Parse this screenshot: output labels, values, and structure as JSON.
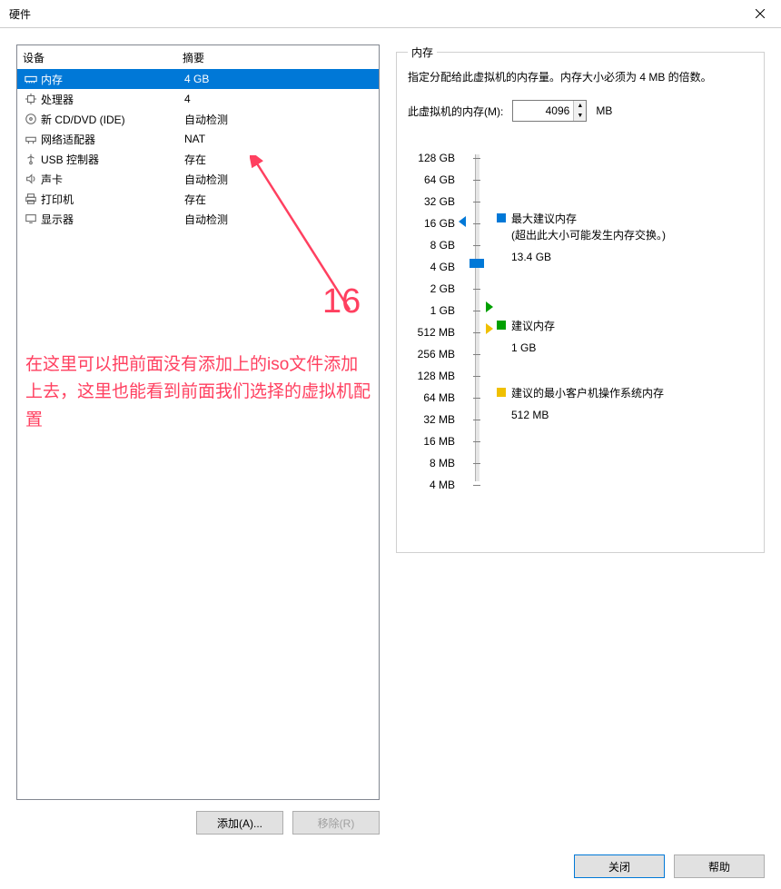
{
  "window": {
    "title": "硬件"
  },
  "device_list": {
    "header_device": "设备",
    "header_summary": "摘要",
    "items": [
      {
        "name": "内存",
        "summary": "4 GB",
        "icon": "memory-icon",
        "selected": true
      },
      {
        "name": "处理器",
        "summary": "4",
        "icon": "cpu-icon",
        "selected": false
      },
      {
        "name": "新 CD/DVD (IDE)",
        "summary": "自动检测",
        "icon": "disc-icon",
        "selected": false
      },
      {
        "name": "网络适配器",
        "summary": "NAT",
        "icon": "network-icon",
        "selected": false
      },
      {
        "name": "USB 控制器",
        "summary": "存在",
        "icon": "usb-icon",
        "selected": false
      },
      {
        "name": "声卡",
        "summary": "自动检测",
        "icon": "sound-icon",
        "selected": false
      },
      {
        "name": "打印机",
        "summary": "存在",
        "icon": "printer-icon",
        "selected": false
      },
      {
        "name": "显示器",
        "summary": "自动检测",
        "icon": "display-icon",
        "selected": false
      }
    ]
  },
  "buttons": {
    "add": "添加(A)...",
    "remove": "移除(R)",
    "close": "关闭",
    "help": "帮助"
  },
  "memory": {
    "group_title": "内存",
    "description": "指定分配给此虚拟机的内存量。内存大小必须为 4 MB 的倍数。",
    "input_label": "此虚拟机的内存(M):",
    "value": "4096",
    "unit": "MB",
    "ticks": [
      "128 GB",
      "64 GB",
      "32 GB",
      "16 GB",
      "8 GB",
      "4 GB",
      "2 GB",
      "1 GB",
      "512 MB",
      "256 MB",
      "128 MB",
      "64 MB",
      "32 MB",
      "16 MB",
      "8 MB",
      "4 MB"
    ],
    "markers": {
      "max": {
        "label": "最大建议内存",
        "note": "(超出此大小可能发生内存交换。)",
        "value": "13.4 GB",
        "color": "#0078d7"
      },
      "rec": {
        "label": "建议内存",
        "value": "1 GB",
        "color": "#00a000"
      },
      "min": {
        "label": "建议的最小客户机操作系统内存",
        "value": "512 MB",
        "color": "#f0c000"
      }
    }
  },
  "annotation": {
    "number": "16",
    "text": "在这里可以把前面没有添加上的iso文件添加上去，这里也能看到前面我们选择的虚拟机配置"
  }
}
